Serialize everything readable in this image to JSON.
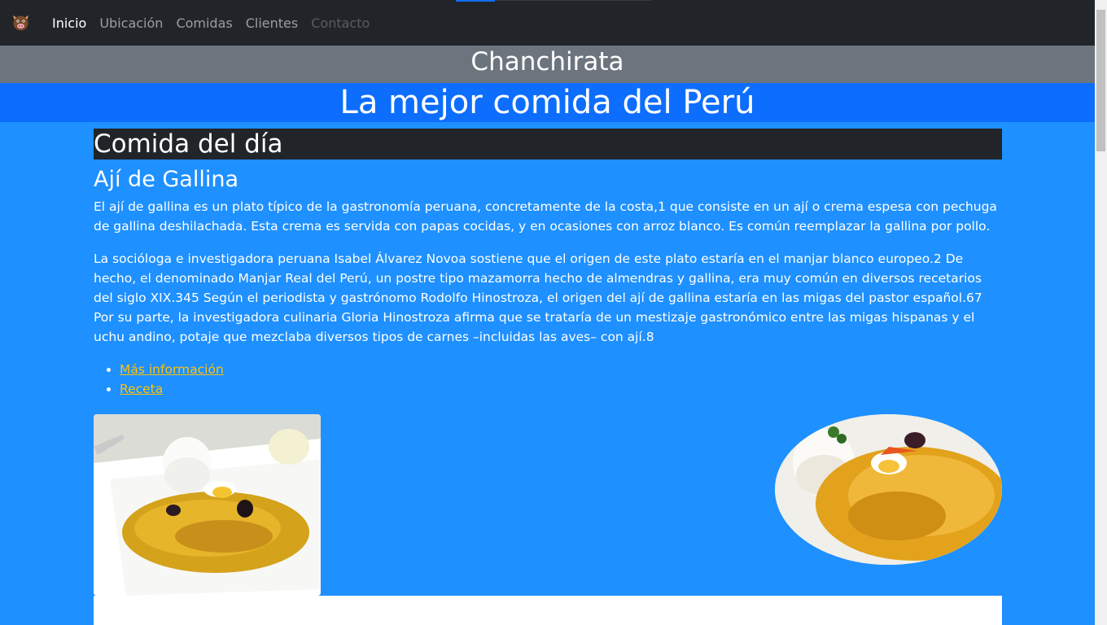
{
  "nav": {
    "brand_icon": "pig-face-icon",
    "links": [
      {
        "label": "Inicio",
        "state": "active"
      },
      {
        "label": "Ubicación",
        "state": "normal"
      },
      {
        "label": "Comidas",
        "state": "normal"
      },
      {
        "label": "Clientes",
        "state": "normal"
      },
      {
        "label": "Contacto",
        "state": "disabled"
      }
    ]
  },
  "header": {
    "title": "Chanchirata",
    "subtitle": "La mejor comida del Perú"
  },
  "main": {
    "section_title": "Comida del día",
    "dish_name": "Ají de Gallina",
    "paragraphs": [
      "El ají de gallina es un plato típico de la gastronomía peruana, concretamente de la costa,1 que consiste en un ají o crema espesa con pechuga de gallina deshilachada. Esta crema es servida con papas cocidas, y en ocasiones con arroz blanco. Es común reemplazar la gallina por pollo.",
      "La socióloga e investigadora peruana Isabel Álvarez Novoa sostiene que el origen de este plato estaría en el manjar blanco europeo.2 De hecho, el denominado Manjar Real del Perú, un postre tipo mazamorra hecho de almendras y gallina, era muy común en diversos recetarios del siglo XIX.345 Según el periodista y gastrónomo Rodolfo Hinostroza, el origen del ají de gallina estaría en las migas del pastor español.67 Por su parte, la investigadora culinaria Gloria Hinostroza afirma que se trataría de un mestizaje gastronómico entre las migas hispanas y el uchu andino, potaje que mezclaba diversos tipos de carnes –incluidas las aves– con ají.8"
    ],
    "links": [
      "Más información",
      "Receta"
    ]
  },
  "colors": {
    "navbar": "#212529",
    "title_band": "#6c757d",
    "subtitle_band": "#0d6efd",
    "page_bg": "#1e90ff",
    "link": "#ffc107"
  }
}
